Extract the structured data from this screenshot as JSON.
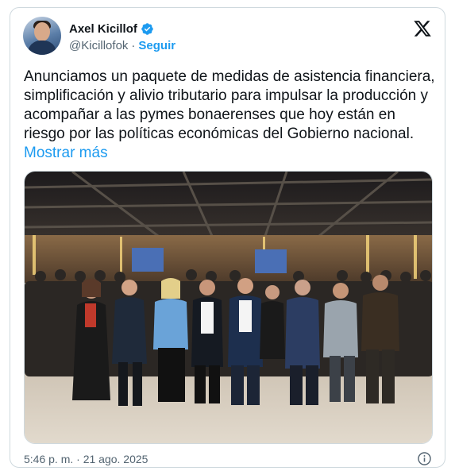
{
  "author": {
    "display_name": "Axel Kicillof",
    "handle": "@Kicillofok",
    "separator": "·",
    "follow_label": "Seguir",
    "verified": true
  },
  "tweet": {
    "text": "Anunciamos un paquete de medidas de asistencia financiera, simplificación y alivio tributario para impulsar la producción y acompañar a las pymes bonaerenses que hoy están en riesgo por las políticas económicas del Gobierno nacional.",
    "show_more_label": "Mostrar más"
  },
  "meta": {
    "timestamp": "5:46 p. m. · 21 ago. 2025"
  },
  "icons": {
    "platform_logo": "x-logo-icon",
    "verified_badge": "verified-badge-icon",
    "info": "info-icon"
  },
  "colors": {
    "accent": "#1d9bf0",
    "text_primary": "#0f1419",
    "text_secondary": "#536471",
    "border": "#cfd9de"
  }
}
